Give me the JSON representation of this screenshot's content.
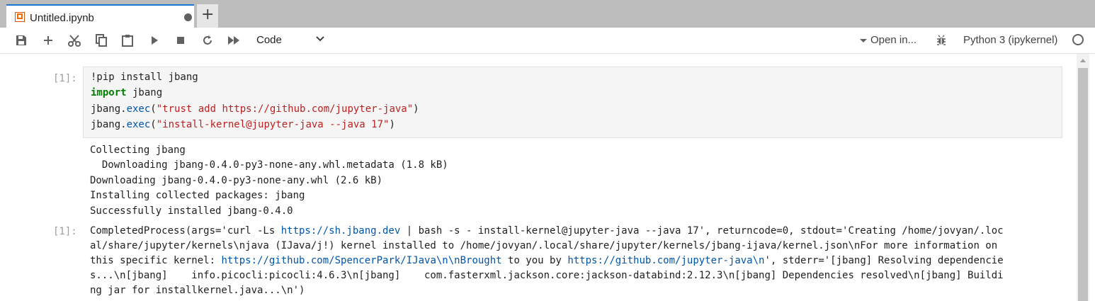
{
  "tab": {
    "title": "Untitled.ipynb",
    "new_tab_label": "+"
  },
  "toolbar": {
    "icons": [
      "save-icon",
      "add-icon",
      "cut-icon",
      "copy-icon",
      "paste-icon",
      "run-icon",
      "stop-icon",
      "restart-icon",
      "fast-forward-icon"
    ],
    "cell_type": "Code",
    "open_in": "Open in...",
    "kernel": "Python 3 (ipykernel)"
  },
  "cell": {
    "input_prompt": "[1]:",
    "lines": [
      [
        {
          "t": "!pip install jbang",
          "c": ""
        }
      ],
      [
        {
          "t": "import",
          "c": "kw"
        },
        {
          "t": " jbang",
          "c": ""
        }
      ],
      [
        {
          "t": "jbang.",
          "c": ""
        },
        {
          "t": "exec",
          "c": "fn"
        },
        {
          "t": "(",
          "c": ""
        },
        {
          "t": "\"trust add https://github.com/jupyter-java\"",
          "c": "str"
        },
        {
          "t": ")",
          "c": ""
        }
      ],
      [
        {
          "t": "jbang.",
          "c": ""
        },
        {
          "t": "exec",
          "c": "fn"
        },
        {
          "t": "(",
          "c": ""
        },
        {
          "t": "\"install-kernel@jupyter-java --java 17\"",
          "c": "str"
        },
        {
          "t": ")",
          "c": ""
        }
      ]
    ],
    "stream_output": [
      "Collecting jbang",
      "  Downloading jbang-0.4.0-py3-none-any.whl.metadata (1.8 kB)",
      "Downloading jbang-0.4.0-py3-none-any.whl (2.6 kB)",
      "Installing collected packages: jbang",
      "Successfully installed jbang-0.4.0"
    ],
    "result_prompt": "[1]:",
    "result_lines": [
      [
        {
          "t": "CompletedProcess(args='curl -Ls ",
          "c": ""
        },
        {
          "t": "https://sh.jbang.dev",
          "c": "link"
        },
        {
          "t": " | bash -s - install-kernel@jupyter-java --java 17', returncode=0, stdout='Creating /home/jovyan/.loc",
          "c": ""
        }
      ],
      [
        {
          "t": "al/share/jupyter/kernels\\njava (IJava/j!) kernel installed to /home/jovyan/.local/share/jupyter/kernels/jbang-ijava/kernel.json\\nFor more information on",
          "c": ""
        }
      ],
      [
        {
          "t": "this specific kernel: ",
          "c": ""
        },
        {
          "t": "https://github.com/SpencerPark/IJava\\n\\nBrought",
          "c": "link"
        },
        {
          "t": " to you by ",
          "c": ""
        },
        {
          "t": "https://github.com/jupyter-java\\n",
          "c": "link"
        },
        {
          "t": "', stderr='[jbang] Resolving dependencie",
          "c": ""
        }
      ],
      [
        {
          "t": "s...\\n[jbang]    info.picocli:picocli:4.6.3\\n[jbang]    com.fasterxml.jackson.core:jackson-databind:2.12.3\\n[jbang] Dependencies resolved\\n[jbang] Buildi",
          "c": ""
        }
      ],
      [
        {
          "t": "ng jar for installkernel.java...\\n')",
          "c": ""
        }
      ]
    ]
  }
}
